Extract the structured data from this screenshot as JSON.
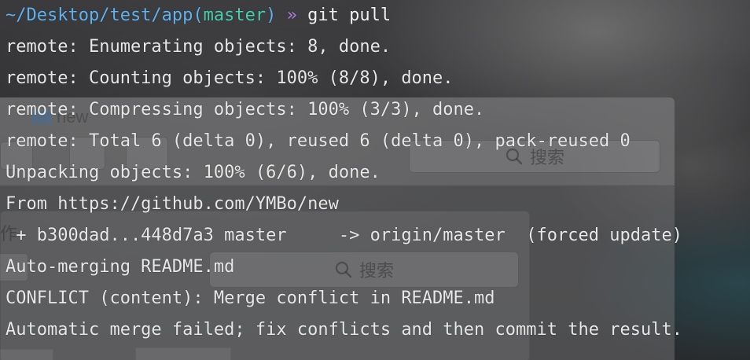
{
  "colors": {
    "path": "#5fb3f0",
    "branch": "#46d0b0",
    "prompt_symbol": "#b57fe0",
    "text": "#e8e8e8"
  },
  "prompt": {
    "path_prefix": "~/Desktop/test/app(",
    "branch": "master",
    "path_suffix": ")",
    "symbol": "»",
    "command": "git pull"
  },
  "output": [
    "remote: Enumerating objects: 8, done.",
    "remote: Counting objects: 100% (8/8), done.",
    "remote: Compressing objects: 100% (3/3), done.",
    "remote: Total 6 (delta 0), reused 6 (delta 0), pack-reused 0",
    "Unpacking objects: 100% (6/6), done.",
    "From https://github.com/YMBo/new",
    " + b300dad...448d7a3 master     -> origin/master  (forced update)",
    "Auto-merging README.md",
    "CONFLICT (content): Merge conflict in README.md",
    "Automatic merge failed; fix conflicts and then commit the result."
  ],
  "background_window": {
    "title": "new",
    "search_placeholder": "搜索",
    "search_placeholder_2": "搜索",
    "glyph": "作"
  }
}
